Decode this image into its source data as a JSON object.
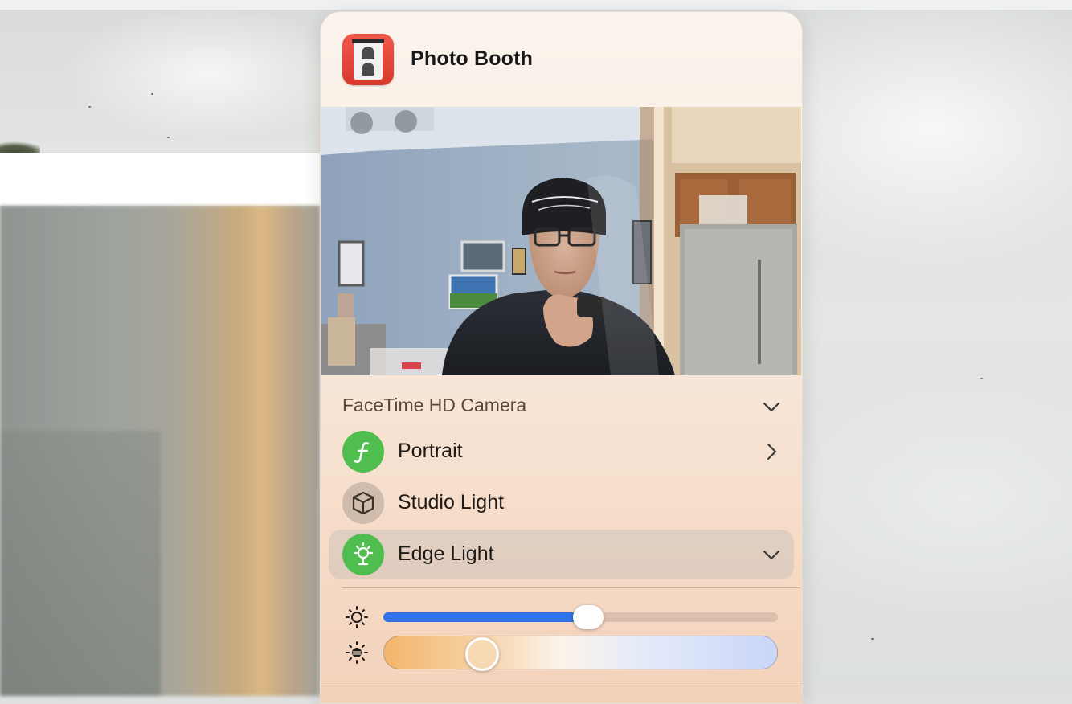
{
  "app": {
    "name": "Photo Booth",
    "icon": "photo-booth-app-icon"
  },
  "camera": {
    "selected": "FaceTime HD Camera"
  },
  "effects": [
    {
      "label": "Portrait",
      "icon": "portrait-f-icon",
      "state": "on",
      "accessory": "chevron-right-icon"
    },
    {
      "label": "Studio Light",
      "icon": "cube-icon",
      "state": "off",
      "accessory": ""
    },
    {
      "label": "Edge Light",
      "icon": "edge-light-icon",
      "state": "on",
      "accessory": "chevron-down-icon",
      "expanded": true
    }
  ],
  "edge_light": {
    "brightness": 0.52,
    "brightness_icon": "sun-icon",
    "color_temperature": 0.25,
    "color_temperature_icon": "warm-light-icon"
  },
  "colors": {
    "accent_blue": "#2f73e4",
    "effect_on_green": "#4fbe4f",
    "app_icon_red": "#e0463a"
  }
}
